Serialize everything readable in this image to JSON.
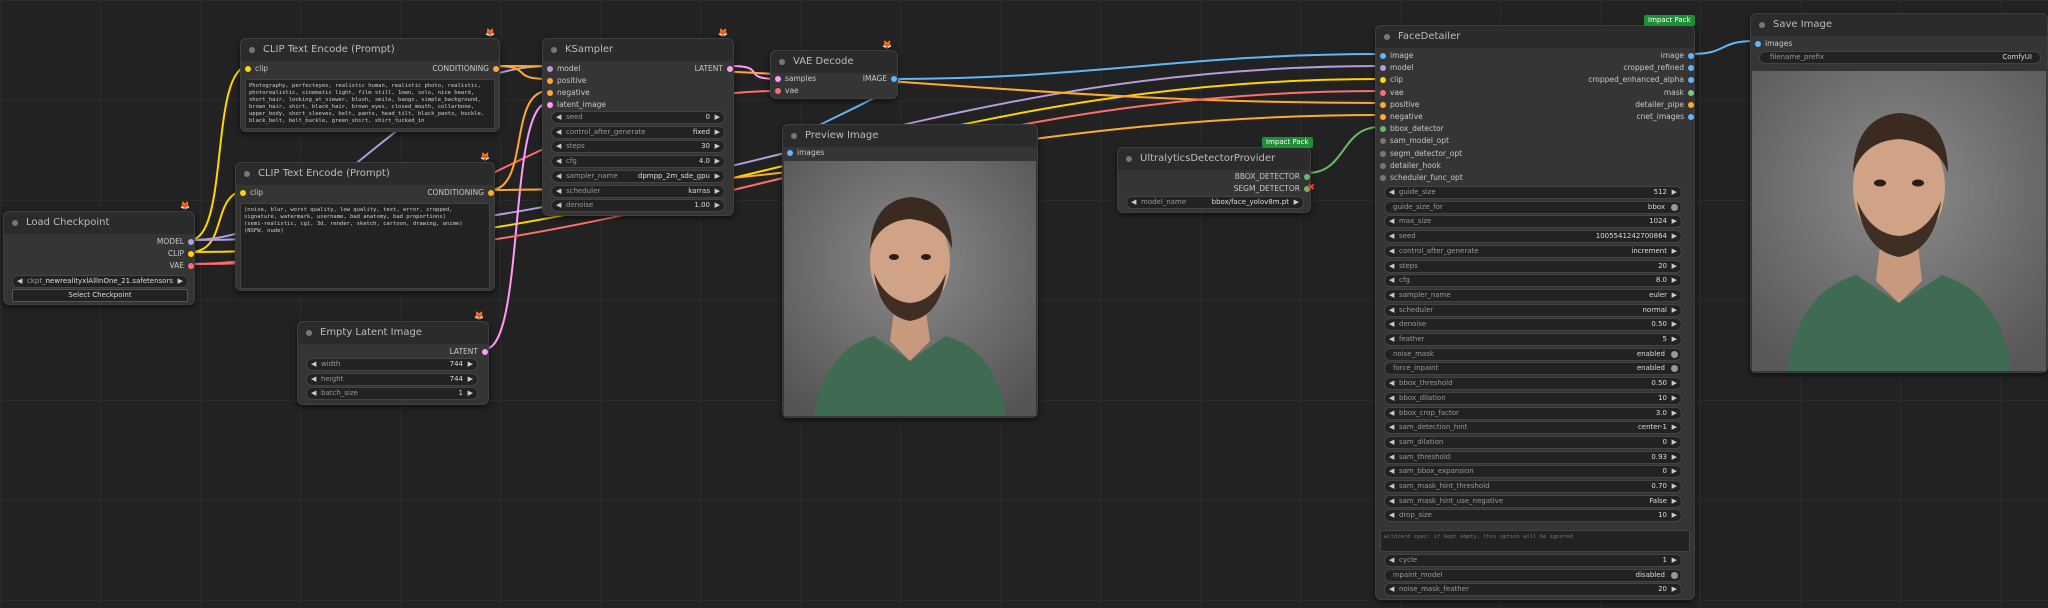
{
  "colors": {
    "model": "#b39ddb",
    "clip": "#ffd500",
    "vae": "#ff6e6e",
    "conditioning": "#ffa931",
    "latent": "#ff9cf9",
    "image": "#64b5f6",
    "bbox": "#66bb6a",
    "segm": "#66bb6a",
    "background": "#222222"
  },
  "load_checkpoint": {
    "title": "Load Checkpoint",
    "outputs": [
      "MODEL",
      "CLIP",
      "VAE"
    ],
    "ckpt_label": "ckpt_n",
    "ckpt_value": "newrealityxlAllInOne_21.safetensors",
    "button": "Select Checkpoint"
  },
  "clip_pos": {
    "title": "CLIP Text Encode (Prompt)",
    "input": "clip",
    "output": "CONDITIONING",
    "text": "Photography, perfecteyes, realistic human, realistic photo, realistic, photorealistic, cinematic light, film still, 1man, solo, nice beard, short_hair, looking_at_viewer, blush, smile, bangs, simple_background, brown_hair, shirt, black_hair, brown_eyes, closed_mouth, collarbone, upper_body, short_sleeves, belt, pants, head_tilt, black_pants, buckle, black_belt, belt_buckle, green_shirt, shirt_tucked_in"
  },
  "clip_neg": {
    "title": "CLIP Text Encode (Prompt)",
    "input": "clip",
    "output": "CONDITIONING",
    "text": "(noise, blur, worst quality, low quality, text, error, cropped, signature, watermark, username, bad anatomy, bad proportions)\n(semi-realistic, cgi, 3d, render, sketch, cartoon, drawing, anime)\n(NSFW, nude)"
  },
  "empty_latent": {
    "title": "Empty Latent Image",
    "output": "LATENT",
    "widgets": [
      {
        "label": "width",
        "value": "744"
      },
      {
        "label": "height",
        "value": "744"
      },
      {
        "label": "batch_size",
        "value": "1"
      }
    ]
  },
  "ksampler": {
    "title": "KSampler",
    "inputs": [
      "model",
      "positive",
      "negative",
      "latent_image"
    ],
    "output": "LATENT",
    "widgets": [
      {
        "label": "seed",
        "value": "0"
      },
      {
        "label": "control_after_generate",
        "value": "fixed"
      },
      {
        "label": "steps",
        "value": "30"
      },
      {
        "label": "cfg",
        "value": "4.0"
      },
      {
        "label": "sampler_name",
        "value": "dpmpp_2m_sde_gpu"
      },
      {
        "label": "scheduler",
        "value": "karras"
      },
      {
        "label": "denoise",
        "value": "1.00"
      }
    ]
  },
  "vae_decode": {
    "title": "VAE Decode",
    "inputs": [
      "samples",
      "vae"
    ],
    "output": "IMAGE"
  },
  "preview": {
    "title": "Preview Image",
    "input": "images"
  },
  "ultra": {
    "title": "UltralyticsDetectorProvider",
    "badge": "Impact Pack",
    "outputs": [
      "BBOX_DETECTOR",
      "SEGM_DETECTOR"
    ],
    "model_label": "model_name",
    "model_value": "bbox/face_yolov8m.pt"
  },
  "face": {
    "title": "FaceDetailer",
    "badge": "Impact Pack",
    "inputs": [
      "image",
      "model",
      "clip",
      "vae",
      "positive",
      "negative",
      "bbox_detector",
      "sam_model_opt",
      "segm_detector_opt",
      "detailer_hook",
      "scheduler_func_opt"
    ],
    "outputs": [
      "image",
      "cropped_refined",
      "cropped_enhanced_alpha",
      "mask",
      "detailer_pipe",
      "cnet_images"
    ],
    "widgets": [
      {
        "label": "guide_size",
        "value": "512",
        "kind": "num"
      },
      {
        "label": "guide_size_for",
        "value": "bbox",
        "kind": "toggle"
      },
      {
        "label": "max_size",
        "value": "1024",
        "kind": "num"
      },
      {
        "label": "seed",
        "value": "1005541242700864",
        "kind": "num"
      },
      {
        "label": "control_after_generate",
        "value": "increment",
        "kind": "num"
      },
      {
        "label": "steps",
        "value": "20",
        "kind": "num"
      },
      {
        "label": "cfg",
        "value": "8.0",
        "kind": "num"
      },
      {
        "label": "sampler_name",
        "value": "euler",
        "kind": "num"
      },
      {
        "label": "scheduler",
        "value": "normal",
        "kind": "num"
      },
      {
        "label": "denoise",
        "value": "0.50",
        "kind": "num"
      },
      {
        "label": "feather",
        "value": "5",
        "kind": "num"
      },
      {
        "label": "noise_mask",
        "value": "enabled",
        "kind": "toggle"
      },
      {
        "label": "force_inpaint",
        "value": "enabled",
        "kind": "toggle"
      },
      {
        "label": "bbox_threshold",
        "value": "0.50",
        "kind": "num"
      },
      {
        "label": "bbox_dilation",
        "value": "10",
        "kind": "num"
      },
      {
        "label": "bbox_crop_factor",
        "value": "3.0",
        "kind": "num"
      },
      {
        "label": "sam_detection_hint",
        "value": "center-1",
        "kind": "num"
      },
      {
        "label": "sam_dilation",
        "value": "0",
        "kind": "num"
      },
      {
        "label": "sam_threshold",
        "value": "0.93",
        "kind": "num"
      },
      {
        "label": "sam_bbox_expansion",
        "value": "0",
        "kind": "num"
      },
      {
        "label": "sam_mask_hint_threshold",
        "value": "0.70",
        "kind": "num"
      },
      {
        "label": "sam_mask_hint_use_negative",
        "value": "False",
        "kind": "num"
      },
      {
        "label": "drop_size",
        "value": "10",
        "kind": "num"
      }
    ],
    "wildcard_placeholder": "wildcard spec: if kept empty, this option will be ignored",
    "widgets2": [
      {
        "label": "cycle",
        "value": "1",
        "kind": "num"
      },
      {
        "label": "inpaint_model",
        "value": "disabled",
        "kind": "toggle"
      },
      {
        "label": "noise_mask_feather",
        "value": "20",
        "kind": "num"
      }
    ]
  },
  "save": {
    "title": "Save Image",
    "input": "images",
    "prefix_label": "filename_prefix",
    "prefix_value": "ComfyUI"
  }
}
